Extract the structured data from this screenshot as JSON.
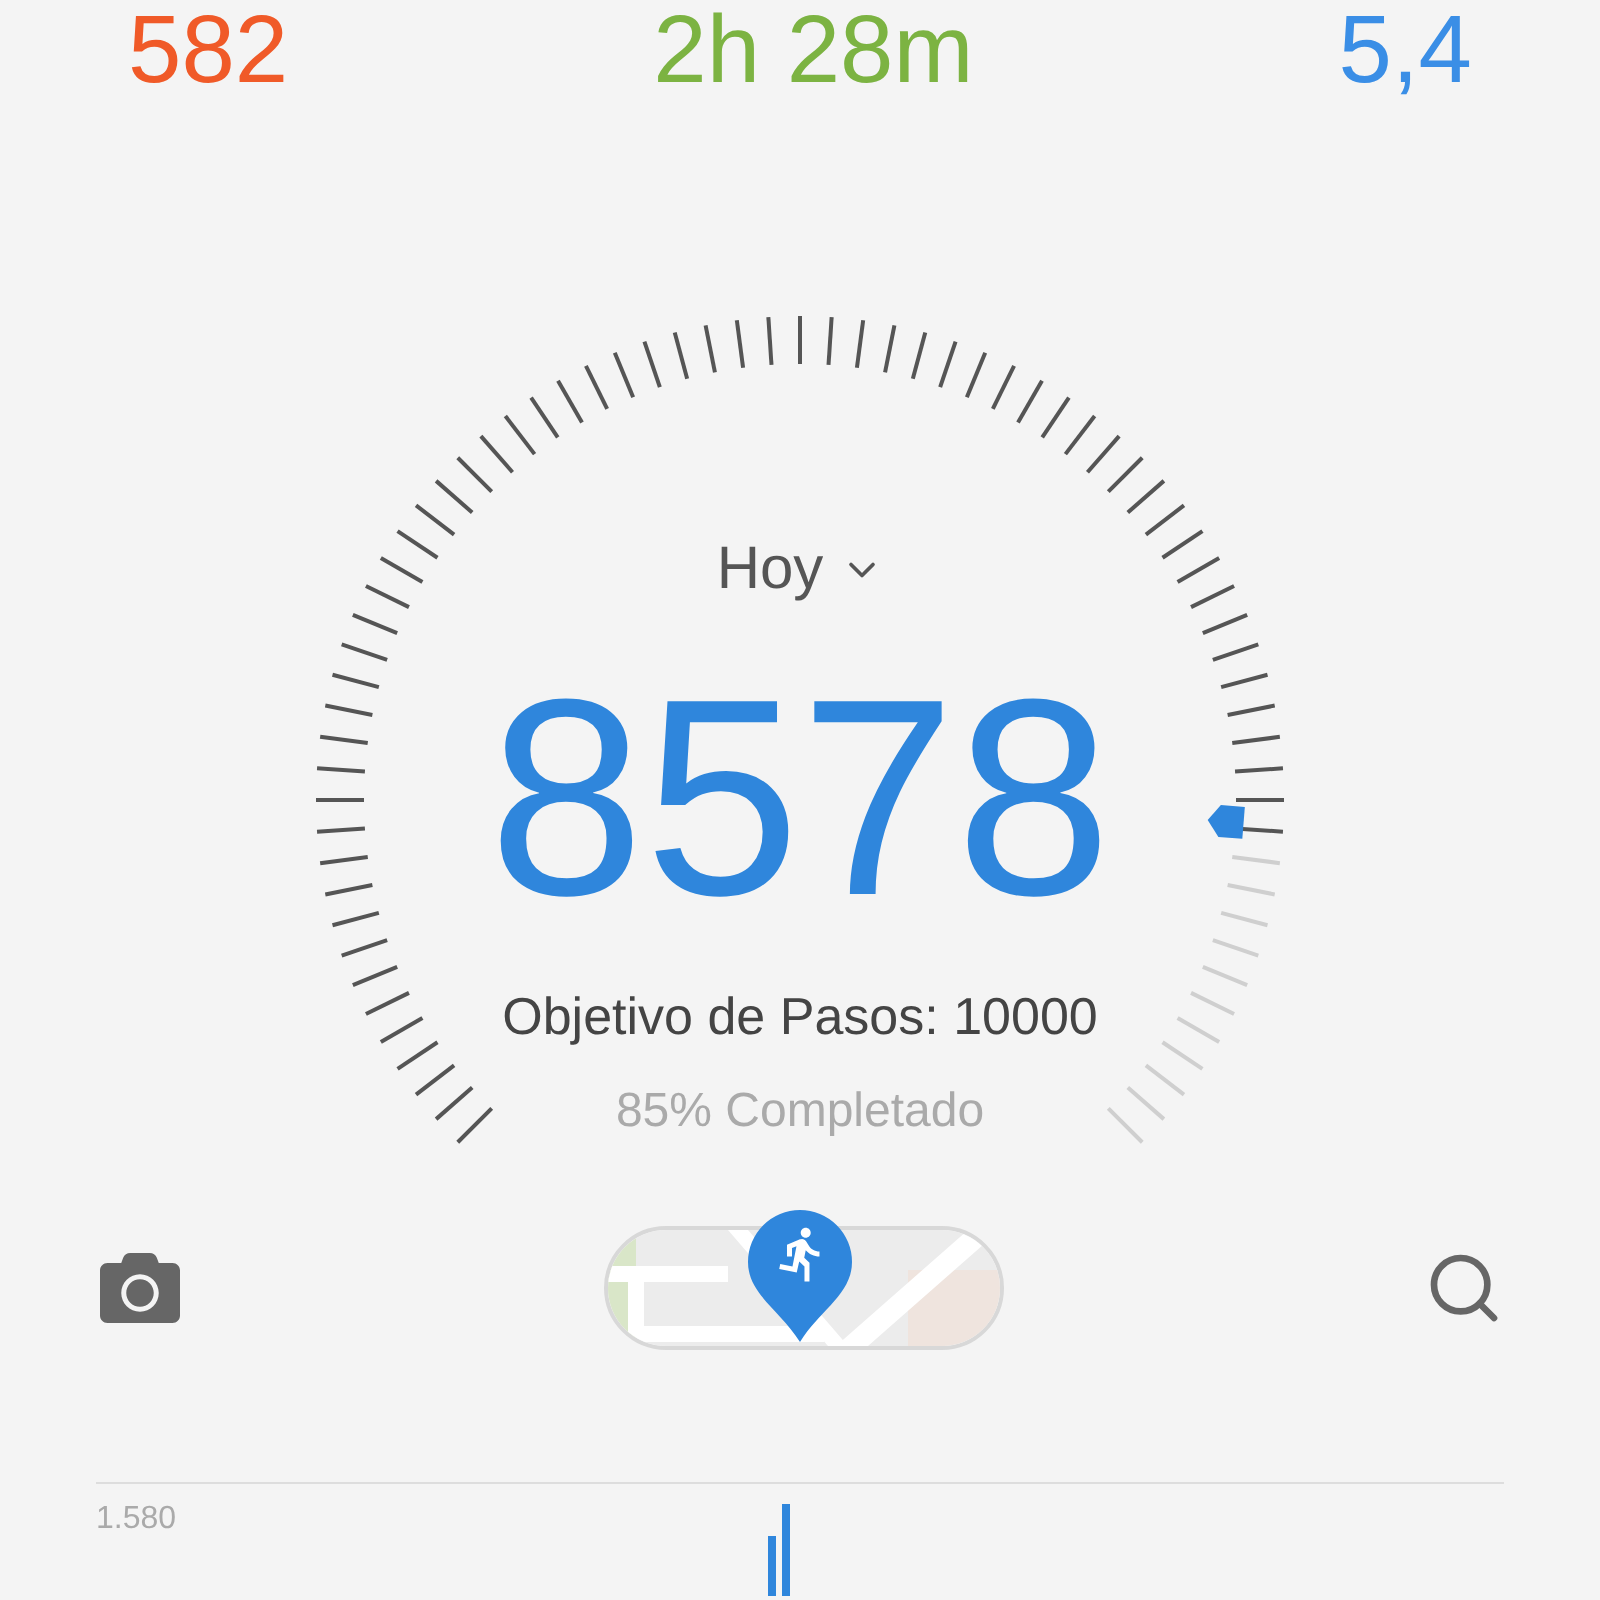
{
  "stats": [
    {
      "value": "582",
      "color": "#f05a28"
    },
    {
      "value": "2h 28m",
      "color": "#7cb342"
    },
    {
      "value": "5,4",
      "color": "#3a8ee6"
    }
  ],
  "gauge": {
    "period": "Hoy",
    "steps": "8578",
    "goal": "Objetivo de Pasos: 10000",
    "completed": "85% Completado"
  },
  "chart": {
    "max_label": "1.580"
  }
}
